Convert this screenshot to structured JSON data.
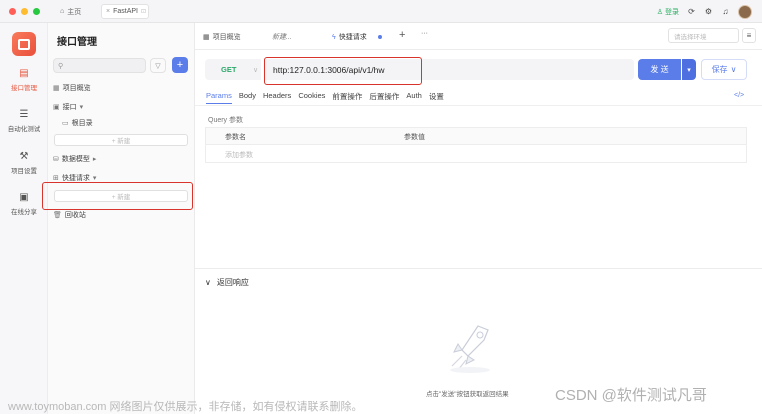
{
  "titlebar": {
    "home_label": "主页",
    "project_tab": "FastAPI",
    "login_label": "登录"
  },
  "rail": [
    {
      "label": "接口管理",
      "icon": "api-icon",
      "active": true
    },
    {
      "label": "自动化测试",
      "icon": "automation-icon",
      "active": false
    },
    {
      "label": "项目设置",
      "icon": "settings-icon",
      "active": false
    },
    {
      "label": "在线分享",
      "icon": "share-icon",
      "active": false
    }
  ],
  "sidebar": {
    "title": "接口管理",
    "search_placeholder": "",
    "overview": "项目概览",
    "interfaces": "接口",
    "root": "根目录",
    "new_label": "+ 新建",
    "data_model": "数据模型",
    "quick_request": "快捷请求",
    "new_label_2": "+ 新建",
    "recycle": "回收站"
  },
  "tabs": {
    "overview": "项目概览",
    "new_tab": "新建...",
    "quick": "快捷请求",
    "env_placeholder": "请选择环境"
  },
  "request": {
    "method": "GET",
    "url": "http:127.0.0.1:3006/api/v1/hw",
    "send": "发 送",
    "save": "保存"
  },
  "req_tabs": [
    "Params",
    "Body",
    "Headers",
    "Cookies",
    "前置操作",
    "后置操作",
    "Auth",
    "设置"
  ],
  "params": {
    "section_label": "Query 参数",
    "col_name": "参数名",
    "col_value": "参数值",
    "add_placeholder": "添加参数"
  },
  "response": {
    "title": "返回响应",
    "hint": "点击\"发送\"按钮获取返回结果"
  },
  "watermark": "www.toymoban.com 网络图片仅供展示，非存储，如有侵权请联系删除。",
  "csdn": "CSDN @软件测试凡哥",
  "colors": {
    "accent": "#5b7dea",
    "brand": "#e9503d",
    "get_method": "#2ca86b",
    "highlight": "#d9342b"
  }
}
